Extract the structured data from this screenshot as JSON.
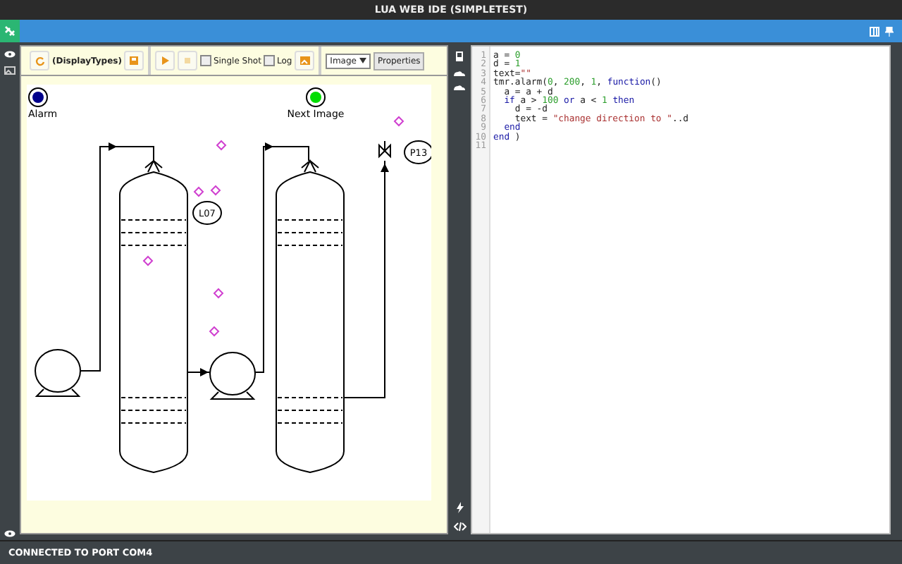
{
  "window": {
    "title": "LUA WEB IDE (SIMPLETEST)"
  },
  "toolbar": {
    "display_label": "(DisplayTypes)",
    "checkboxes": [
      {
        "label": "Single Shot",
        "checked": false
      },
      {
        "label": "Log",
        "checked": false
      }
    ],
    "view_select": "Image",
    "properties_button": "Properties"
  },
  "canvas": {
    "indicators": [
      {
        "label": "Alarm",
        "color": "#00008b"
      },
      {
        "label": "Next Image",
        "color": "#00dd00"
      }
    ],
    "tags": [
      "L07",
      "P13"
    ]
  },
  "editor": {
    "lines": [
      {
        "number": "1",
        "tokens": [
          {
            "kind": "plain",
            "text": "a = "
          },
          {
            "kind": "number",
            "text": "0"
          }
        ]
      },
      {
        "number": "2",
        "tokens": [
          {
            "kind": "plain",
            "text": "d = "
          },
          {
            "kind": "number",
            "text": "1"
          }
        ]
      },
      {
        "number": "3",
        "tokens": [
          {
            "kind": "plain",
            "text": "text="
          },
          {
            "kind": "string",
            "text": "\"\""
          }
        ]
      },
      {
        "number": "4",
        "tokens": [
          {
            "kind": "plain",
            "text": "tmr.alarm("
          },
          {
            "kind": "number",
            "text": "0"
          },
          {
            "kind": "plain",
            "text": ", "
          },
          {
            "kind": "number",
            "text": "200"
          },
          {
            "kind": "plain",
            "text": ", "
          },
          {
            "kind": "number",
            "text": "1"
          },
          {
            "kind": "plain",
            "text": ", "
          },
          {
            "kind": "keyword",
            "text": "function"
          },
          {
            "kind": "plain",
            "text": "()"
          }
        ]
      },
      {
        "number": "5",
        "tokens": [
          {
            "kind": "indent"
          },
          {
            "kind": "plain",
            "text": "a = a + d"
          }
        ]
      },
      {
        "number": "6",
        "tokens": [
          {
            "kind": "indent"
          },
          {
            "kind": "keyword",
            "text": "if"
          },
          {
            "kind": "plain",
            "text": " a > "
          },
          {
            "kind": "number",
            "text": "100"
          },
          {
            "kind": "keyword",
            "text": " or"
          },
          {
            "kind": "plain",
            "text": " a < "
          },
          {
            "kind": "number",
            "text": "1"
          },
          {
            "kind": "keyword",
            "text": " then"
          }
        ]
      },
      {
        "number": "7",
        "tokens": [
          {
            "kind": "indent"
          },
          {
            "kind": "indent"
          },
          {
            "kind": "plain",
            "text": "d = -d"
          }
        ]
      },
      {
        "number": "8",
        "tokens": [
          {
            "kind": "indent"
          },
          {
            "kind": "indent"
          },
          {
            "kind": "plain",
            "text": "text = "
          },
          {
            "kind": "string",
            "text": "\"change direction to \""
          },
          {
            "kind": "plain",
            "text": "..d"
          }
        ]
      },
      {
        "number": "9",
        "tokens": [
          {
            "kind": "indent"
          },
          {
            "kind": "keyword",
            "text": "end"
          }
        ]
      },
      {
        "number": "10",
        "tokens": [
          {
            "kind": "keyword",
            "text": "end"
          },
          {
            "kind": "plain",
            "text": " )"
          }
        ]
      },
      {
        "number": "11"
      }
    ]
  },
  "status_bar": "CONNECTED TO PORT COM4"
}
